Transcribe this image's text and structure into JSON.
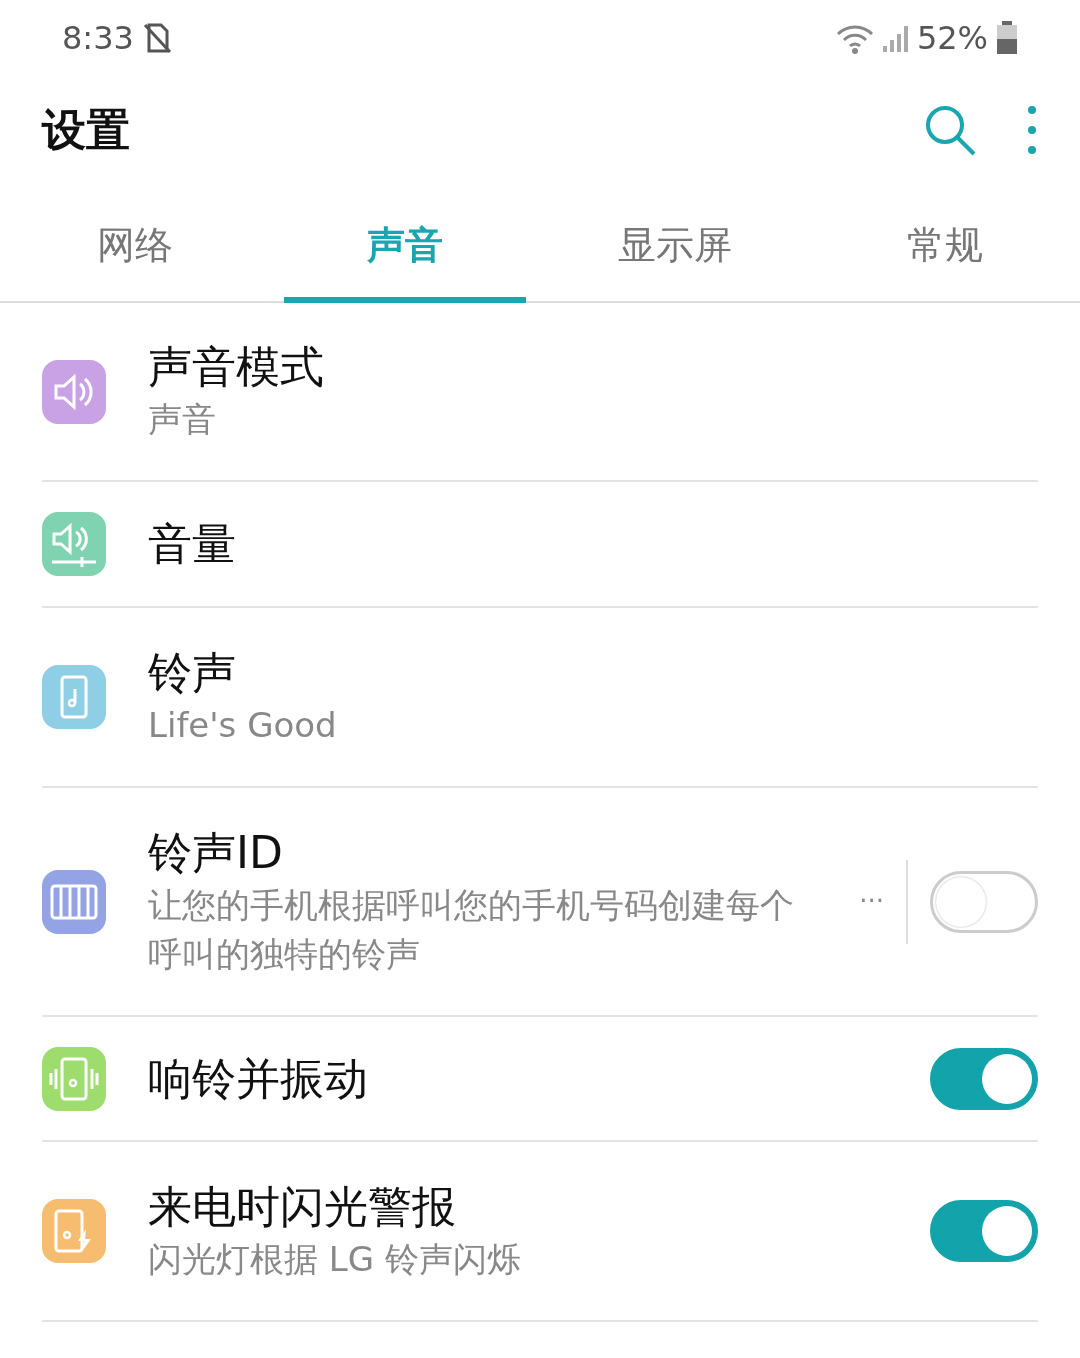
{
  "status_bar": {
    "time": "8:33",
    "battery": "52%"
  },
  "app_bar": {
    "title": "设置"
  },
  "tabs": [
    {
      "label": "网络",
      "selected": false
    },
    {
      "label": "声音",
      "selected": true
    },
    {
      "label": "显示屏",
      "selected": false
    },
    {
      "label": "常规",
      "selected": false
    }
  ],
  "items": [
    {
      "kind": "plain",
      "title": "声音模式",
      "subtitle": "声音",
      "color": "#c9a2e6"
    },
    {
      "kind": "plain",
      "title": "音量",
      "color": "#7fd3b1"
    },
    {
      "kind": "plain",
      "title": "铃声",
      "subtitle": "Life's Good",
      "color": "#8ecfe6"
    },
    {
      "kind": "switch",
      "title": "铃声ID",
      "subtitle": "让您的手机根据呼叫您的手机号码创建每个呼叫的独特的铃声",
      "more_label": "···",
      "on": false,
      "color": "#93a3e3"
    },
    {
      "kind": "switch",
      "title": "响铃并振动",
      "on": true,
      "color": "#9edc6e"
    },
    {
      "kind": "switch",
      "title": "来电时闪光警报",
      "subtitle": "闪光灯根据 LG 铃声闪烁",
      "on": true,
      "color": "#f6bd70"
    }
  ]
}
